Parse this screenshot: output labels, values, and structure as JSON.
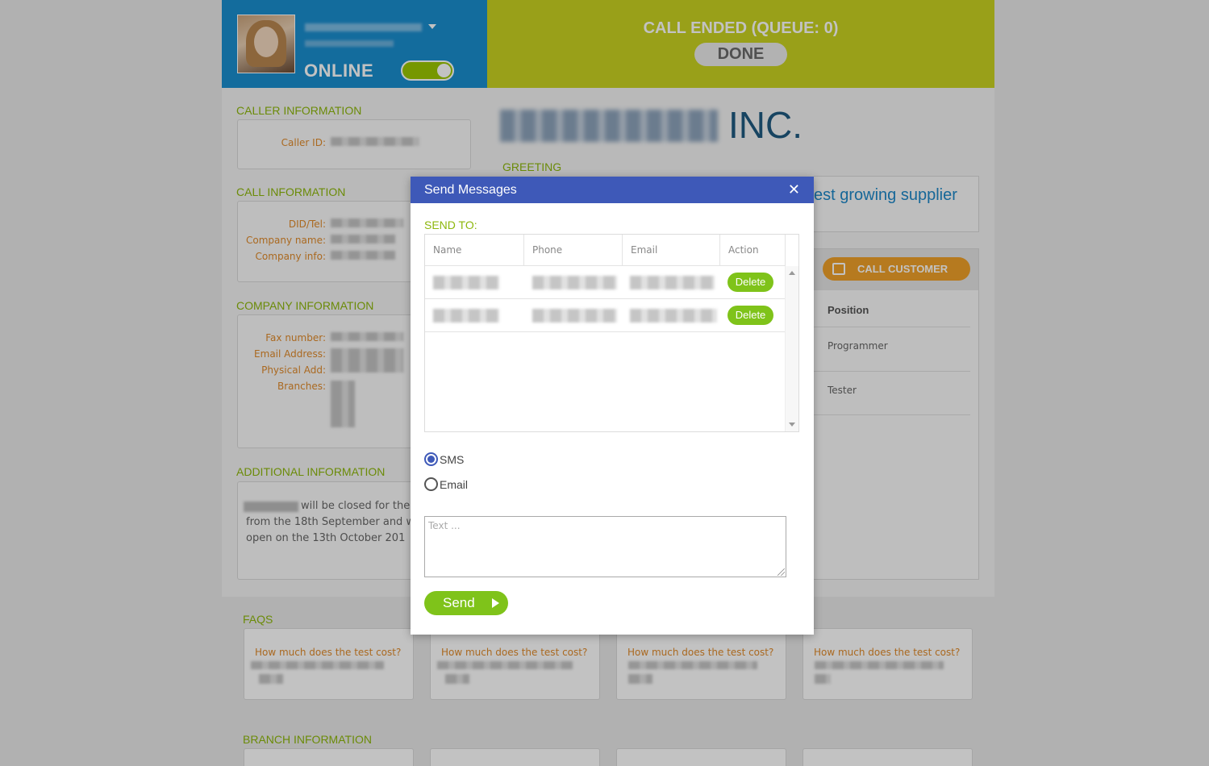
{
  "agent": {
    "status": "ONLINE"
  },
  "call": {
    "status_text": "CALL ENDED (QUEUE: 0)",
    "done_label": "DONE"
  },
  "company": {
    "suffix": "INC.",
    "greeting_fragment": "est growing supplier"
  },
  "sections": {
    "caller_info": "CALLER INFORMATION",
    "call_info": "CALL INFORMATION",
    "company_info": "COMPANY INFORMATION",
    "additional_info": "ADDITIONAL INFORMATION",
    "greeting": "GREETING",
    "faqs": "FAQS",
    "branch_info": "BRANCH INFORMATION"
  },
  "caller": {
    "caller_id_label": "Caller ID:"
  },
  "call_details": {
    "labels": [
      "DID/Tel:",
      "Company name:",
      "Company info:"
    ]
  },
  "company_details": {
    "labels": [
      "Fax number:",
      "Email Address:",
      "Physical Add:",
      "Branches:"
    ]
  },
  "additional": {
    "line1": "will be closed for the",
    "line2": "from the 18th September and w",
    "line3": "open on the 13th October 201"
  },
  "contacts_panel": {
    "call_customer_label": "CALL CUSTOMER",
    "position_header": "Position",
    "positions": [
      "Programmer",
      "Tester"
    ]
  },
  "faqs": {
    "questions": [
      "How much does the test cost?",
      "How much does the test cost?",
      "How much does the test cost?",
      "How much does the test cost?"
    ]
  },
  "modal": {
    "title": "Send Messages",
    "close_symbol": "✕",
    "send_to_label": "SEND TO:",
    "columns": [
      "Name",
      "Phone",
      "Email",
      "Action"
    ],
    "rows": [
      {
        "action": "Delete"
      },
      {
        "action": "Delete"
      }
    ],
    "options": [
      {
        "label": "SMS",
        "checked": true
      },
      {
        "label": "Email",
        "checked": false
      }
    ],
    "text_placeholder": "Text ...",
    "send_label": "Send"
  },
  "colors": {
    "header_blue": "#1a8ecf",
    "header_lime": "#c9d321",
    "modal_header": "#3e59b8",
    "accent_green": "#7fc31a",
    "section_green": "#8db70b",
    "label_orange": "#e08a2b",
    "call_orange": "#f0a12a"
  }
}
